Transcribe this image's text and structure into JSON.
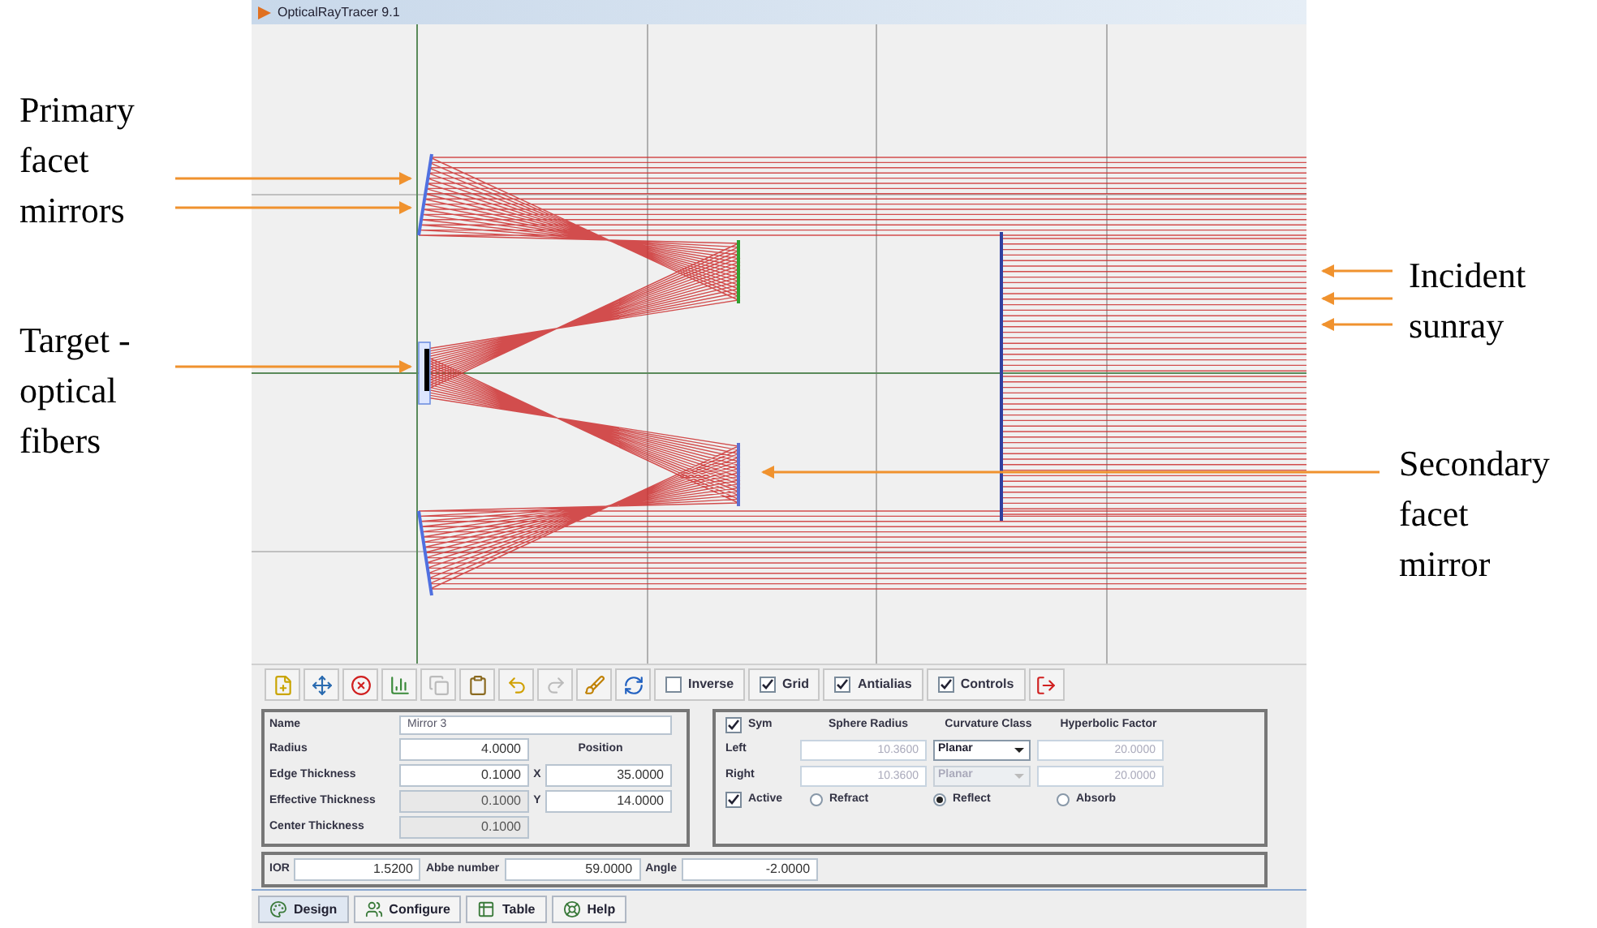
{
  "window": {
    "title": "OpticalRayTracer 9.1"
  },
  "annotations": [
    {
      "text": "Primary\nfacet\nmirrors"
    },
    {
      "text": "Target -\noptical\nfibers"
    },
    {
      "text": "Incident\nsunray"
    },
    {
      "text": "Secondary\nfacet\nmirror"
    }
  ],
  "toolbar": {
    "icon_buttons": [
      {
        "disabled": false
      },
      {
        "disabled": false
      },
      {
        "disabled": false
      },
      {
        "disabled": false
      },
      {
        "disabled": true
      },
      {
        "disabled": false
      },
      {
        "disabled": false
      },
      {
        "disabled": true
      },
      {
        "disabled": false
      },
      {
        "disabled": false
      }
    ],
    "checkboxes": [
      {
        "label": "Inverse",
        "checked": false
      },
      {
        "label": "Grid",
        "checked": true
      },
      {
        "label": "Antialias",
        "checked": true
      },
      {
        "label": "Controls",
        "checked": true
      }
    ]
  },
  "element": {
    "name_label": "Name",
    "name": "Mirror 3",
    "fields": [
      {
        "label": "Radius",
        "value": "4.0000",
        "disabled": false
      },
      {
        "label": "Edge Thickness",
        "value": "0.1000",
        "disabled": false
      },
      {
        "label": "Effective Thickness",
        "value": "0.1000",
        "disabled": true
      },
      {
        "label": "Center Thickness",
        "value": "0.1000",
        "disabled": true
      }
    ],
    "position_label": "Position",
    "position": [
      {
        "label": "X",
        "value": "35.0000"
      },
      {
        "label": "Y",
        "value": "14.0000"
      }
    ]
  },
  "surfaces": {
    "sym": {
      "label": "Sym",
      "checked": true
    },
    "columns": [
      "Sphere Radius",
      "Curvature Class",
      "Hyperbolic Factor"
    ],
    "rows": [
      {
        "label": "Left",
        "sphere_radius": "10.3600",
        "curvature_class": "Planar",
        "hyperbolic_factor": "20.0000",
        "disabled": false
      },
      {
        "label": "Right",
        "sphere_radius": "10.3600",
        "curvature_class": "Planar",
        "hyperbolic_factor": "20.0000",
        "disabled": true
      }
    ],
    "active": {
      "label": "Active",
      "checked": true
    },
    "modes": [
      {
        "label": "Refract",
        "selected": false
      },
      {
        "label": "Reflect",
        "selected": true
      },
      {
        "label": "Absorb",
        "selected": false
      }
    ]
  },
  "optics": [
    {
      "label": "IOR",
      "value": "1.5200"
    },
    {
      "label": "Abbe number",
      "value": "59.0000"
    },
    {
      "label": "Angle",
      "value": "-2.0000"
    }
  ],
  "tabs": [
    {
      "label": "Design",
      "selected": true
    },
    {
      "label": "Configure",
      "selected": false
    },
    {
      "label": "Table",
      "selected": false
    },
    {
      "label": "Help",
      "selected": false
    }
  ]
}
